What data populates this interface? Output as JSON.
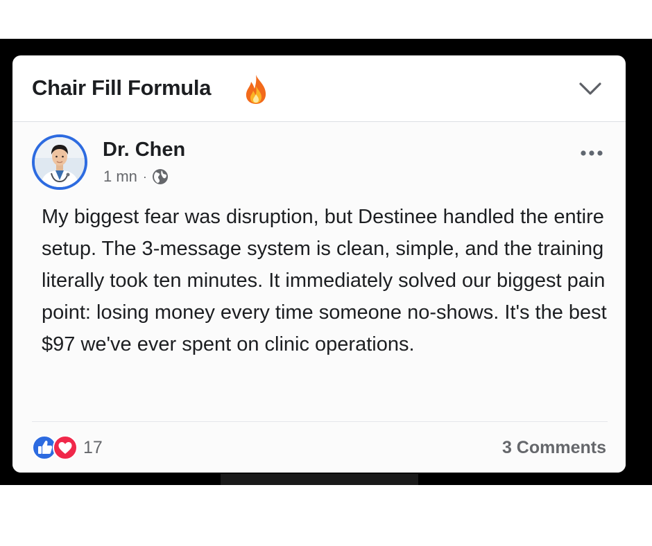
{
  "group": {
    "title": "Chair Fill Formula",
    "title_icon": "fire-emoji-icon",
    "menu_icon": "chevron-down-icon"
  },
  "post": {
    "author": "Dr. Chen",
    "time": "1 mn",
    "separator": "·",
    "privacy_icon": "globe-icon",
    "options_icon": "more-horizontal-icon",
    "text": "My biggest fear was disruption, but Destinee handled the entire setup. The 3-message system is clean, simple, and the training literally took ten minutes. It immediately solved our biggest pain point: losing money every time someone no-shows. It's the best $97 we've ever spent on clinic operations."
  },
  "footer": {
    "reaction_icons": [
      "like-icon",
      "love-icon"
    ],
    "reaction_count": "17",
    "comments_label": "3 Comments"
  },
  "colors": {
    "facebook_blue": "#2d6be0",
    "love_red": "#f0284a",
    "text_primary": "#1c1e21",
    "text_secondary": "#65676b"
  }
}
